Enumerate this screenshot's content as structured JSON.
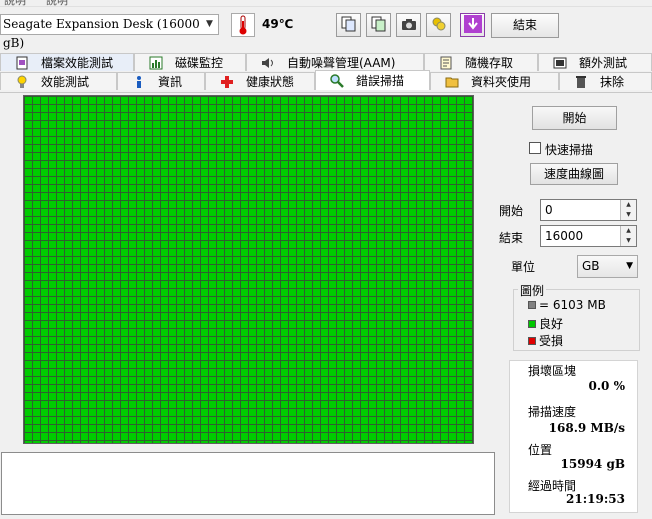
{
  "menu": {
    "items": [
      "說明",
      "說明"
    ]
  },
  "toolbar": {
    "drive": "Seagate Expansion Desk (16000 gB)",
    "temperature": "49℃",
    "exit_label": "結束",
    "icons": [
      "copy-text-icon",
      "copy-report-icon",
      "camera-icon",
      "save-icon",
      "download-icon"
    ]
  },
  "tabs_row1": [
    {
      "label": "檔案效能測試",
      "icon": "file-benchmark-icon"
    },
    {
      "label": "磁碟監控",
      "icon": "disk-monitor-icon"
    },
    {
      "label": "自動噪聲管理(AAM)",
      "icon": "speaker-icon"
    },
    {
      "label": "隨機存取",
      "icon": "random-access-icon"
    },
    {
      "label": "額外測試",
      "icon": "extra-tests-icon"
    }
  ],
  "tabs_row2": [
    {
      "label": "效能測試",
      "icon": "lightbulb-icon"
    },
    {
      "label": "資訊",
      "icon": "info-icon"
    },
    {
      "label": "健康狀態",
      "icon": "health-cross-icon"
    },
    {
      "label": "錯誤掃描",
      "icon": "magnifier-icon"
    },
    {
      "label": "資料夾使用",
      "icon": "folder-icon"
    },
    {
      "label": "抹除",
      "icon": "trash-icon"
    }
  ],
  "scan": {
    "start_button": "開始",
    "quick_scan_label": "快速掃描",
    "quick_scan_checked": false,
    "speed_graph_button": "速度曲線圖",
    "start_label": "開始",
    "start_value": "0",
    "end_label": "結束",
    "end_value": "16000",
    "unit_label": "單位",
    "unit_value": "GB",
    "legend_title": "圖例",
    "legend": [
      {
        "label": "= 6103 MB",
        "color": "#808080"
      },
      {
        "label": "良好",
        "color": "#00c800"
      },
      {
        "label": "受損",
        "color": "#e00000"
      }
    ],
    "stats": {
      "damaged_label": "損壞區塊",
      "damaged_value": "0.0 %",
      "speed_label": "掃描速度",
      "speed_value": "168.9 MB/s",
      "position_label": "位置",
      "position_value": "15994 gB",
      "elapsed_label": "經過時間",
      "elapsed_value": "21:19:53"
    }
  },
  "colors": {
    "good": "#00c800",
    "damaged": "#e00000",
    "grid_line": "#2f5f2f"
  }
}
